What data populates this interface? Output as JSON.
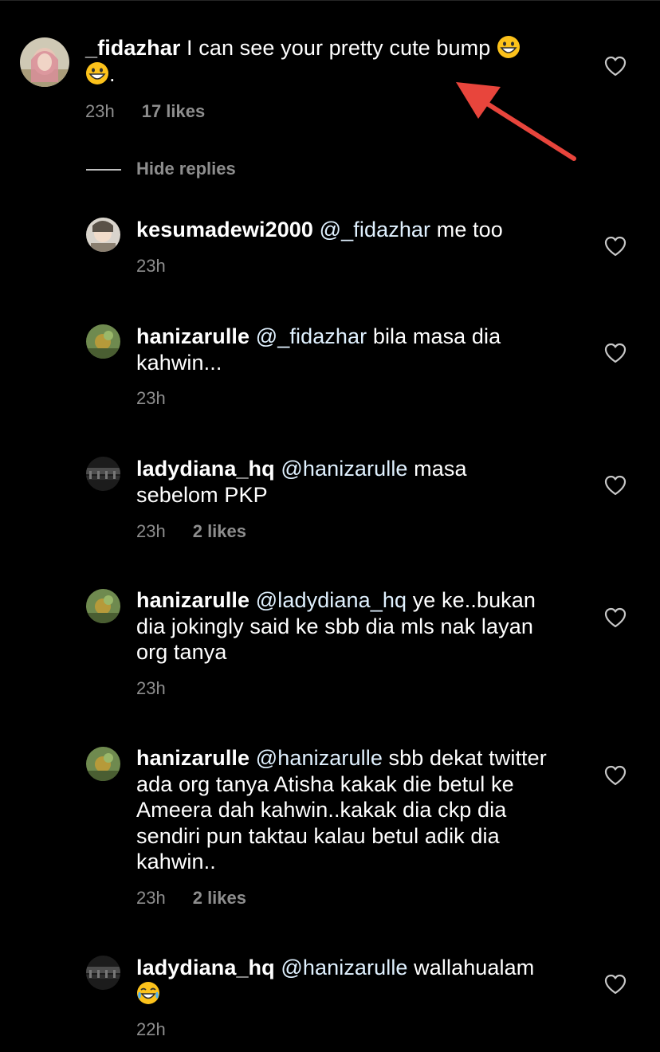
{
  "colors": {
    "background": "#000000",
    "text": "#ffffff",
    "muted": "#8e8e8e",
    "mention": "#e0f1ff",
    "arrow": "#e8453c"
  },
  "main_comment": {
    "username": "_fidazhar",
    "text_line1": " I can see your pretty cute bump ",
    "text_line2": ".",
    "emoji": "grinning-face-emoji",
    "time": "23h",
    "likes": "17 likes"
  },
  "hide_replies_label": "Hide replies",
  "replies": [
    {
      "username": "kesumadewi2000",
      "mention": "@_fidazhar",
      "lines": [
        " me too"
      ],
      "time": "23h",
      "likes": ""
    },
    {
      "username": "hanizarulle",
      "mention": "@_fidazhar",
      "lines": [
        " bila masa dia",
        "kahwin..."
      ],
      "time": "23h",
      "likes": ""
    },
    {
      "username": "ladydiana_hq",
      "mention": "@hanizarulle",
      "lines": [
        " masa",
        "sebelom PKP"
      ],
      "time": "23h",
      "likes": "2 likes"
    },
    {
      "username": "hanizarulle",
      "mention": "@ladydiana_hq",
      "lines": [
        " ye ke..bukan",
        "dia jokingly said ke sbb dia mls nak layan",
        "org tanya"
      ],
      "time": "23h",
      "likes": ""
    },
    {
      "username": "hanizarulle",
      "mention": "@hanizarulle",
      "lines": [
        " sbb dekat twitter",
        "ada org tanya Atisha kakak die betul ke",
        "Ameera dah kahwin..kakak dia ckp dia",
        "sendiri pun taktau kalau betul adik dia",
        "kahwin.."
      ],
      "time": "23h",
      "likes": "2 likes"
    },
    {
      "username": "ladydiana_hq",
      "mention": "@hanizarulle",
      "lines": [
        " wallahualam"
      ],
      "time": "22h",
      "likes": ""
    }
  ],
  "icons": {
    "like": "heart-icon",
    "emoji_reply_last": "tears-of-joy-emoji",
    "annotation": "red-arrow"
  }
}
